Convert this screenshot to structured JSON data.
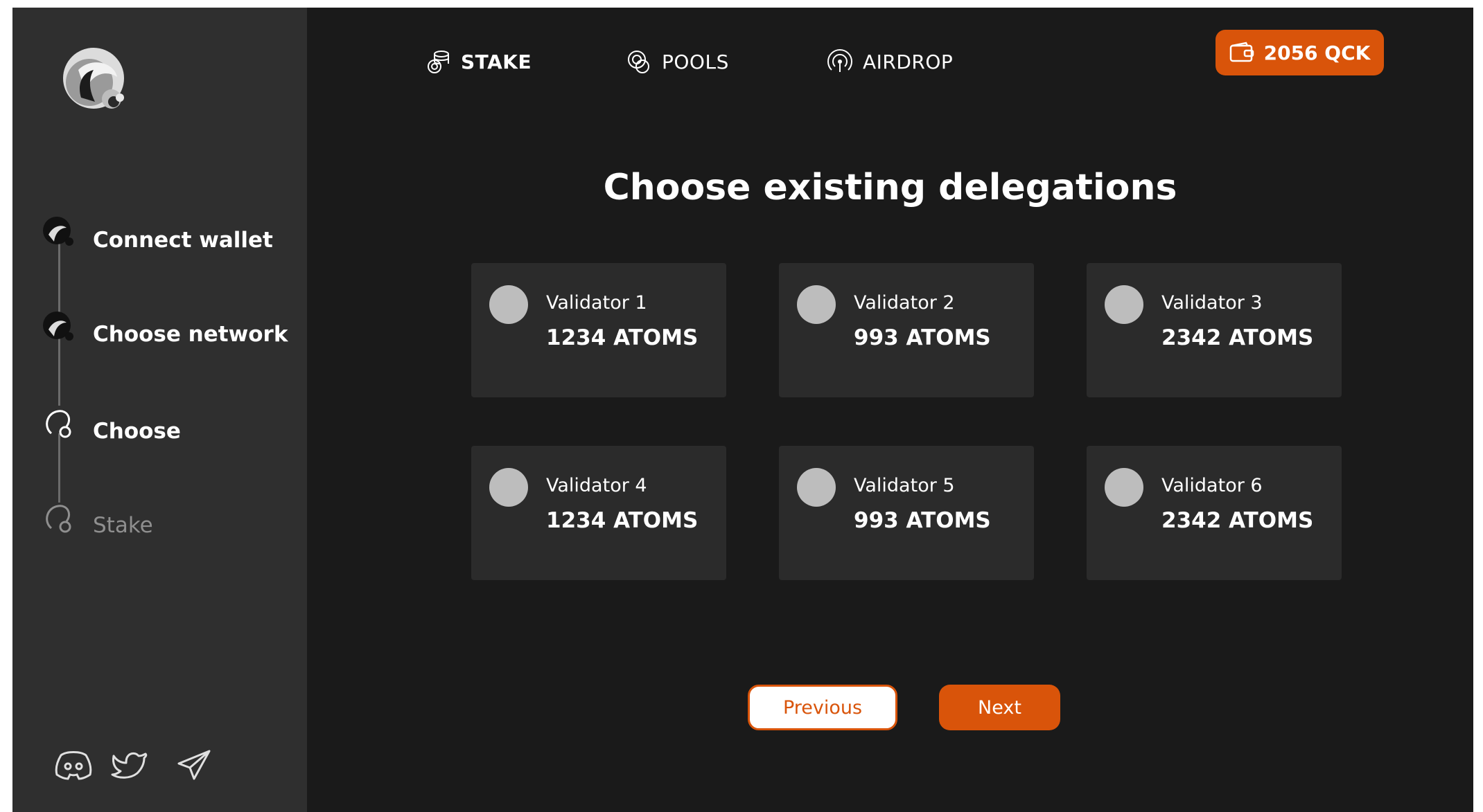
{
  "nav": {
    "items": [
      {
        "label": "STAKE",
        "icon": "coins-stack-icon"
      },
      {
        "label": "POOLS",
        "icon": "coins-icon"
      },
      {
        "label": "AIRDROP",
        "icon": "broadcast-icon"
      }
    ],
    "active": "STAKE"
  },
  "wallet": {
    "balance": "2056 QCK",
    "icon": "wallet-icon"
  },
  "sidebar": {
    "steps": [
      {
        "label": "Connect wallet",
        "state": "done"
      },
      {
        "label": "Choose network",
        "state": "done"
      },
      {
        "label": "Choose",
        "state": "current"
      },
      {
        "label": "Stake",
        "state": "pending"
      }
    ],
    "social": [
      "discord-icon",
      "twitter-icon",
      "telegram-icon"
    ]
  },
  "main": {
    "title": "Choose existing delegations",
    "validators": [
      {
        "name": "Validator 1",
        "amount": "1234 ATOMS"
      },
      {
        "name": "Validator 2",
        "amount": "993 ATOMS"
      },
      {
        "name": "Validator 3",
        "amount": "2342 ATOMS"
      },
      {
        "name": "Validator 4",
        "amount": "1234 ATOMS"
      },
      {
        "name": "Validator 5",
        "amount": "993 ATOMS"
      },
      {
        "name": "Validator 6",
        "amount": "2342 ATOMS"
      }
    ],
    "previous_label": "Previous",
    "next_label": "Next"
  },
  "colors": {
    "accent": "#d9540a",
    "sidebar_bg": "#2f2f2f",
    "main_bg": "#1a1a1a",
    "card_bg": "#2b2b2b"
  }
}
